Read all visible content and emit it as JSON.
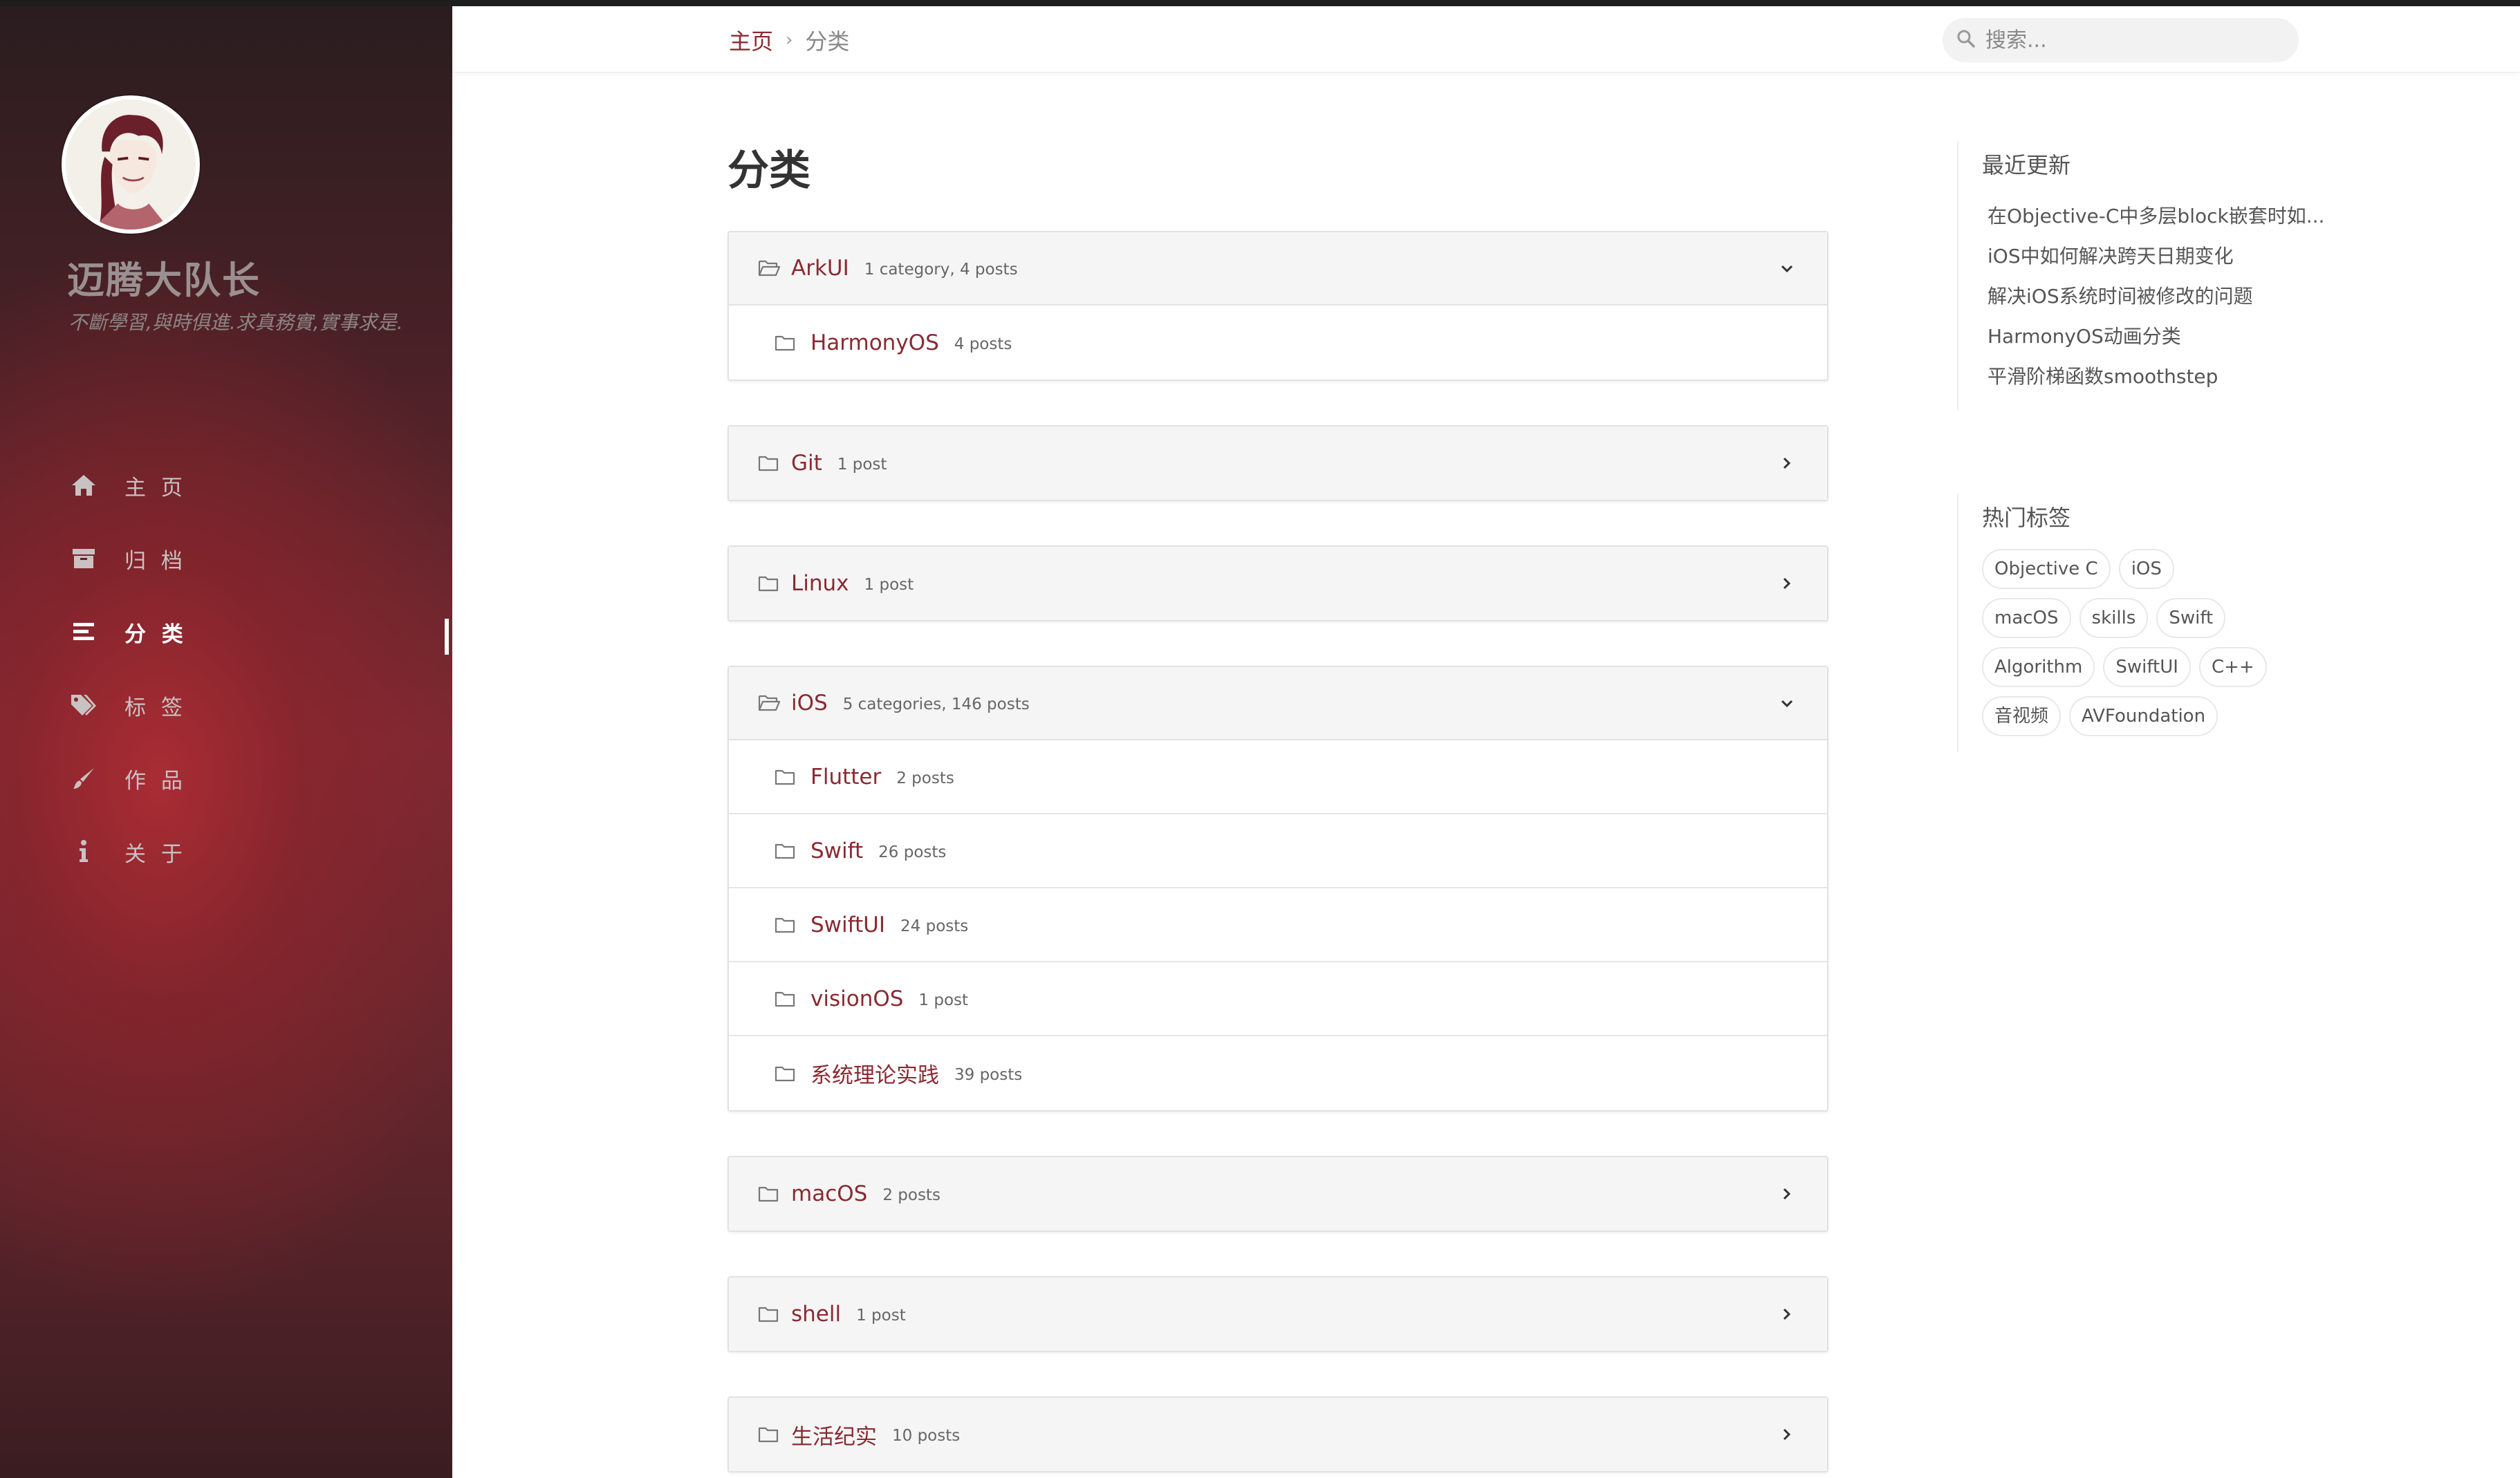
{
  "sidebar": {
    "site_title": "迈腾大队长",
    "subtitle": "不斷學習,與時俱進.求真務實,實事求是.",
    "menu": [
      {
        "label": "主 页",
        "icon": "home-icon"
      },
      {
        "label": "归 档",
        "icon": "archive-icon"
      },
      {
        "label": "分 类",
        "icon": "list-icon",
        "active": true
      },
      {
        "label": "标 签",
        "icon": "tags-icon"
      },
      {
        "label": "作 品",
        "icon": "brush-icon"
      },
      {
        "label": "关 于",
        "icon": "info-icon"
      }
    ]
  },
  "header": {
    "breadcrumb": {
      "home": "主页",
      "separator": "›",
      "current": "分类"
    },
    "search": {
      "placeholder": "搜索...",
      "value": ""
    }
  },
  "main": {
    "title": "分类",
    "categories": [
      {
        "name": "ArkUI",
        "meta": "1 category, 4 posts",
        "expanded": true,
        "children": [
          {
            "name": "HarmonyOS",
            "meta": "4 posts"
          }
        ]
      },
      {
        "name": "Git",
        "meta": "1 post",
        "expanded": false,
        "children": []
      },
      {
        "name": "Linux",
        "meta": "1 post",
        "expanded": false,
        "children": []
      },
      {
        "name": "iOS",
        "meta": "5 categories, 146 posts",
        "expanded": true,
        "children": [
          {
            "name": "Flutter",
            "meta": "2 posts"
          },
          {
            "name": "Swift",
            "meta": "26 posts"
          },
          {
            "name": "SwiftUI",
            "meta": "24 posts"
          },
          {
            "name": "visionOS",
            "meta": "1 post"
          },
          {
            "name": "系统理论实践",
            "meta": "39 posts"
          }
        ]
      },
      {
        "name": "macOS",
        "meta": "2 posts",
        "expanded": false,
        "children": []
      },
      {
        "name": "shell",
        "meta": "1 post",
        "expanded": false,
        "children": []
      },
      {
        "name": "生活纪实",
        "meta": "10 posts",
        "expanded": false,
        "children": []
      }
    ]
  },
  "aside": {
    "recent": {
      "title": "最近更新",
      "items": [
        "在Objective-C中多层block嵌套时如...",
        "iOS中如何解决跨天日期变化",
        "解决iOS系统时间被修改的问题",
        "HarmonyOS动画分类",
        "平滑阶梯函数smoothstep"
      ]
    },
    "tags": {
      "title": "热门标签",
      "items": [
        "Objective C",
        "iOS",
        "macOS",
        "skills",
        "Swift",
        "Algorithm",
        "SwiftUI",
        "C++",
        "音视频",
        "AVFoundation"
      ]
    }
  },
  "colors": {
    "accent": "#8a2a32",
    "sidebar_dark": "#2a1d1f",
    "sidebar_red": "#ac2c34"
  }
}
